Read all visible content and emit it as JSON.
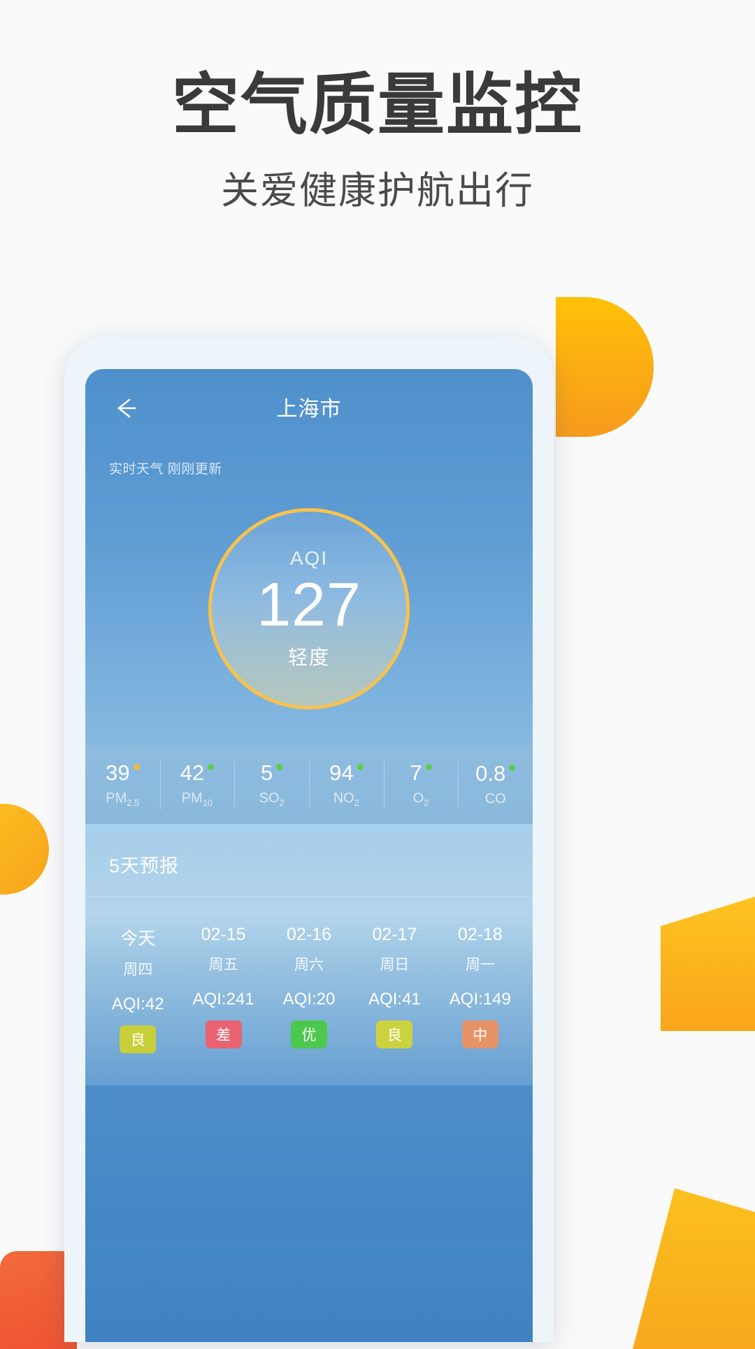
{
  "header": {
    "title": "空气质量监控",
    "subtitle": "关爱健康护航出行"
  },
  "app": {
    "nav": {
      "back_icon": "arrow-left-icon",
      "city": "上海市"
    },
    "update_status": "实时天气 刚刚更新",
    "aqi": {
      "label": "AQI",
      "value": "127",
      "level": "轻度",
      "ring_color": "#f7c24e"
    },
    "pollutants": [
      {
        "value": "39",
        "name": "PM",
        "sub": "2.5",
        "dot_color": "#f5b83d"
      },
      {
        "value": "42",
        "name": "PM",
        "sub": "10",
        "dot_color": "#5fcb4a"
      },
      {
        "value": "5",
        "name": "SO",
        "sub": "2",
        "dot_color": "#5fcb4a"
      },
      {
        "value": "94",
        "name": "NO",
        "sub": "2",
        "dot_color": "#5fcb4a"
      },
      {
        "value": "7",
        "name": "O",
        "sub": "2",
        "dot_color": "#5fcb4a"
      },
      {
        "value": "0.8",
        "name": "CO",
        "sub": "",
        "dot_color": "#5fcb4a"
      }
    ],
    "forecast": {
      "title": "5天预报",
      "days": [
        {
          "date": "今天",
          "week": "周四",
          "aqi": "AQI:42",
          "badge": "良",
          "badge_color": "#c7cf3b"
        },
        {
          "date": "02-15",
          "week": "周五",
          "aqi": "AQI:241",
          "badge": "差",
          "badge_color": "#e8636f"
        },
        {
          "date": "02-16",
          "week": "周六",
          "aqi": "AQI:20",
          "badge": "优",
          "badge_color": "#4cc84c"
        },
        {
          "date": "02-17",
          "week": "周日",
          "aqi": "AQI:41",
          "badge": "良",
          "badge_color": "#ccd23e"
        },
        {
          "date": "02-18",
          "week": "周一",
          "aqi": "AQI:149",
          "badge": "中",
          "badge_color": "#e89267"
        }
      ]
    }
  }
}
